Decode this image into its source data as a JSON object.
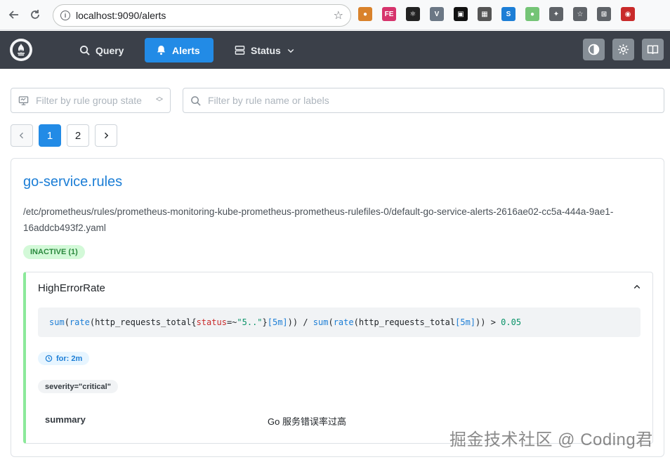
{
  "browser": {
    "url": "localhost:9090/alerts",
    "extensions": [
      {
        "name": "cookie-icon",
        "color": "#d9822b",
        "glyph": "●"
      },
      {
        "name": "fe-extension-icon",
        "color": "#d6336c",
        "glyph": "FE"
      },
      {
        "name": "react-devtools-icon",
        "color": "#222222",
        "glyph": "⚛"
      },
      {
        "name": "vue-devtools-icon",
        "color": "#6b7785",
        "glyph": "V"
      },
      {
        "name": "square-extension-icon",
        "color": "#111111",
        "glyph": "▣"
      },
      {
        "name": "qr-code-icon",
        "color": "#555555",
        "glyph": "▦"
      },
      {
        "name": "s-extension-icon",
        "color": "#1c7ed6",
        "glyph": "S"
      },
      {
        "name": "green-circle-icon",
        "color": "#74c476",
        "glyph": "●"
      },
      {
        "name": "puzzle-icon",
        "color": "#5f6368",
        "glyph": "✦"
      },
      {
        "name": "favorites-icon",
        "color": "#5f6368",
        "glyph": "☆"
      },
      {
        "name": "collections-icon",
        "color": "#5f6368",
        "glyph": "⊞"
      },
      {
        "name": "profile-icon",
        "color": "#c92a2a",
        "glyph": "◉"
      }
    ]
  },
  "nav": {
    "query": "Query",
    "alerts": "Alerts",
    "status": "Status"
  },
  "filters": {
    "group_state_placeholder": "Filter by rule group state",
    "name_placeholder": "Filter by rule name or labels"
  },
  "pagination": {
    "pages": [
      "1",
      "2"
    ],
    "current": "1"
  },
  "group": {
    "name": "go-service.rules",
    "file": "/etc/prometheus/rules/prometheus-monitoring-kube-prometheus-prometheus-rulefiles-0/default-go-service-alerts-2616ae02-cc5a-444a-9ae1-16addcb493f2.yaml",
    "state_badge": "INACTIVE (1)"
  },
  "rule": {
    "name": "HighErrorRate",
    "expr": {
      "fn1": "sum",
      "p1": "(",
      "fn2": "rate",
      "p2": "(",
      "metric1": "http_requests_total",
      "brace_open": "{",
      "label": "status",
      "op": "=~",
      "value": "\"5..\"",
      "brace_close": "}",
      "range1": "[5m]",
      "p3": ")) / ",
      "fn3": "sum",
      "p4": "(",
      "fn4": "rate",
      "p5": "(",
      "metric2": "http_requests_total",
      "range2": "[5m]",
      "p6": ")) > ",
      "threshold": "0.05"
    },
    "for": "for: 2m",
    "label": "severity=\"critical\"",
    "annotation_key": "summary",
    "annotation_value": "Go 服务错误率过高"
  },
  "watermark": "掘金技术社区 @ Coding君",
  "colors": {
    "navbar": "#3b4049",
    "accent": "#228be6",
    "inactive_green": "#2b8a3e",
    "promql_fn": "#1c7ed6",
    "promql_label": "#c92a2a",
    "promql_string": "#099268",
    "promql_number": "#099268"
  }
}
